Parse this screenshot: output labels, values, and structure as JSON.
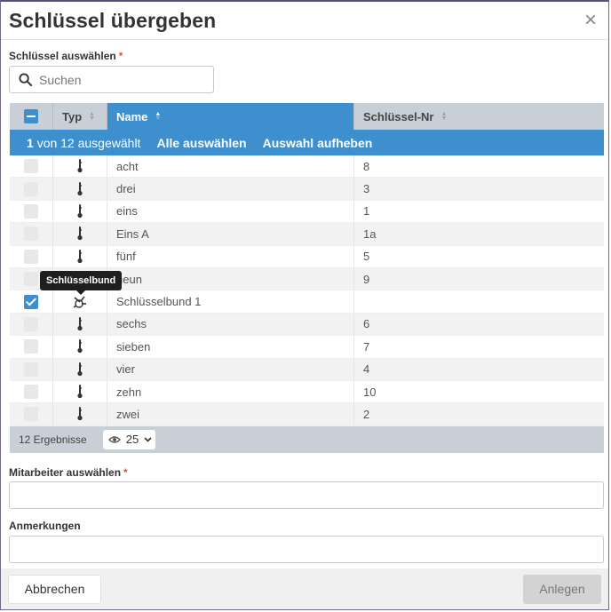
{
  "dialog": {
    "title": "Schlüssel übergeben",
    "close_icon": "×"
  },
  "keys_field": {
    "label": "Schlüssel auswählen",
    "required_mark": "*",
    "search_placeholder": "Suchen"
  },
  "grid": {
    "headers": {
      "typ": "Typ",
      "name": "Name",
      "nr": "Schlüssel-Nr"
    },
    "selection": {
      "count_bold": "1",
      "count_text": "von 12 ausgewählt",
      "select_all": "Alle auswählen",
      "clear": "Auswahl aufheben"
    },
    "rows": [
      {
        "type": "key",
        "name": "acht",
        "nr": "8",
        "checked": false
      },
      {
        "type": "key",
        "name": "drei",
        "nr": "3",
        "checked": false
      },
      {
        "type": "key",
        "name": "eins",
        "nr": "1",
        "checked": false
      },
      {
        "type": "key",
        "name": "Eins A",
        "nr": "1a",
        "checked": false
      },
      {
        "type": "key",
        "name": "fünf",
        "nr": "5",
        "checked": false
      },
      {
        "type": "key",
        "name": "neun",
        "nr": "9",
        "checked": false
      },
      {
        "type": "keyring",
        "name": "Schlüsselbund 1",
        "nr": "",
        "checked": true
      },
      {
        "type": "key",
        "name": "sechs",
        "nr": "6",
        "checked": false
      },
      {
        "type": "key",
        "name": "sieben",
        "nr": "7",
        "checked": false
      },
      {
        "type": "key",
        "name": "vier",
        "nr": "4",
        "checked": false
      },
      {
        "type": "key",
        "name": "zehn",
        "nr": "10",
        "checked": false
      },
      {
        "type": "key",
        "name": "zwei",
        "nr": "2",
        "checked": false
      }
    ],
    "footer": {
      "results": "12 Ergebnisse",
      "page_size": "25"
    },
    "tooltip": "Schlüsselbund"
  },
  "employee_field": {
    "label": "Mitarbeiter auswählen",
    "required_mark": "*",
    "value": ""
  },
  "notes_field": {
    "label": "Anmerkungen",
    "value": ""
  },
  "buttons": {
    "cancel": "Abbrechen",
    "create": "Anlegen"
  },
  "colors": {
    "accent": "#3d8fce",
    "header_gray": "#c9cfd6"
  }
}
